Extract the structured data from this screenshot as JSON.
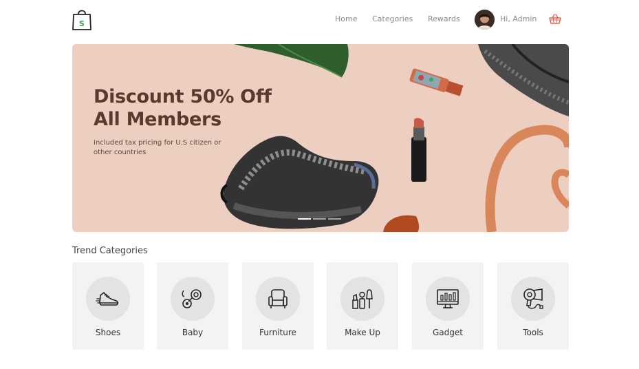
{
  "header": {
    "logo_letter": "S",
    "nav": [
      {
        "label": "Home"
      },
      {
        "label": "Categories"
      },
      {
        "label": "Rewards"
      }
    ],
    "greeting": "Hi, Admin",
    "cart_icon": "basket-icon",
    "avatar_icon": "user-avatar"
  },
  "hero": {
    "title_line1": "Discount 50% Off",
    "title_line2": "All Members",
    "subtitle": "Included tax pricing for U.S citizen or other countries",
    "slides_total": 3,
    "active_slide": 1
  },
  "trend": {
    "title": "Trend Categories",
    "items": [
      {
        "label": "Shoes",
        "icon": "shoe-icon"
      },
      {
        "label": "Baby",
        "icon": "pacifier-icon"
      },
      {
        "label": "Furniture",
        "icon": "armchair-icon"
      },
      {
        "label": "Make Up",
        "icon": "makeup-icon"
      },
      {
        "label": "Gadget",
        "icon": "monitor-icon"
      },
      {
        "label": "Tools",
        "icon": "hairdryer-icon"
      }
    ]
  },
  "colors": {
    "brand_green": "#2fa84f",
    "cart_red": "#e8604c",
    "hero_bg": "#eccfc1",
    "hero_title": "#5a3a2e",
    "card_bg": "#f3f3f3"
  }
}
